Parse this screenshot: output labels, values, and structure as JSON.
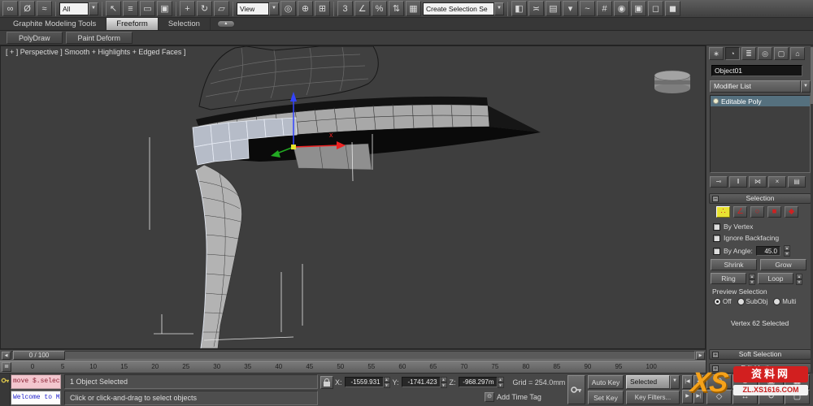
{
  "ui": {
    "dd_arrow": "▼",
    "left_arrow": "◀",
    "right_arrow": "▶",
    "spin_up": "▲",
    "spin_down": "▼",
    "minus": "−"
  },
  "toolbar": {
    "filter_dropdown": "All",
    "coord_dropdown": "View",
    "selection_set_dropdown": "Create Selection Se",
    "groups": {
      "link": [
        {
          "name": "select-and-link-icon",
          "glyph": "∞"
        },
        {
          "name": "unlink-selection-icon",
          "glyph": "Ø"
        },
        {
          "name": "bind-to-spacewarp-icon",
          "glyph": "≈"
        }
      ],
      "select": [
        {
          "name": "select-object-icon",
          "glyph": "↖"
        },
        {
          "name": "select-by-name-icon",
          "glyph": "≡"
        },
        {
          "name": "rectangular-selection-region-icon",
          "glyph": "▭"
        },
        {
          "name": "window-crossing-icon",
          "glyph": "▣"
        }
      ],
      "transform": [
        {
          "name": "select-and-move-icon",
          "glyph": "+"
        },
        {
          "name": "select-and-rotate-icon",
          "glyph": "↻"
        },
        {
          "name": "select-and-scale-icon",
          "glyph": "▱"
        }
      ],
      "pivot": [
        {
          "name": "use-pivot-point-center-icon",
          "glyph": "◎"
        },
        {
          "name": "select-and-manipulate-icon",
          "glyph": "⊕"
        },
        {
          "name": "keyboard-shortcut-override-icon",
          "glyph": "⊞"
        }
      ],
      "snap": [
        {
          "name": "snap-toggle-3d-icon",
          "glyph": "3"
        },
        {
          "name": "angle-snap-icon",
          "glyph": "∠"
        },
        {
          "name": "percent-snap-icon",
          "glyph": "%"
        },
        {
          "name": "spinner-snap-icon",
          "glyph": "⇅"
        },
        {
          "name": "named-selection-sets-icon",
          "glyph": "▦"
        }
      ],
      "tools": [
        {
          "name": "mirror-icon",
          "glyph": "◧"
        },
        {
          "name": "align-icon",
          "glyph": "≍"
        },
        {
          "name": "layer-manager-icon",
          "glyph": "▤"
        },
        {
          "name": "graphite-ribbon-toggle-icon",
          "glyph": "▾"
        },
        {
          "name": "curve-editor-icon",
          "glyph": "~"
        },
        {
          "name": "schematic-view-icon",
          "glyph": "#"
        },
        {
          "name": "material-editor-icon",
          "glyph": "◉"
        },
        {
          "name": "render-setup-icon",
          "glyph": "▣"
        },
        {
          "name": "rendered-frame-window-icon",
          "glyph": "◻"
        },
        {
          "name": "render-production-icon",
          "glyph": "◼"
        }
      ]
    }
  },
  "ribbon": {
    "toggle_glyph": "▴",
    "tabs": [
      {
        "name": "tab-graphite-modeling-tools",
        "label": "Graphite Modeling Tools"
      },
      {
        "name": "tab-freeform",
        "label": "Freeform",
        "active": true
      },
      {
        "name": "tab-selection",
        "label": "Selection"
      }
    ],
    "panels": [
      {
        "name": "panel-polydraw",
        "label": "PolyDraw"
      },
      {
        "name": "panel-paint-deform",
        "label": "Paint Deform"
      }
    ]
  },
  "viewport": {
    "label": "[ + ]  Perspective ]  Smooth + Highlights + Edged Faces ]",
    "gizmo_x_label": "x"
  },
  "timeline": {
    "slider_label": "0 / 100",
    "mini_curve_glyph": "≣",
    "ticks": [
      "0",
      "5",
      "10",
      "15",
      "20",
      "25",
      "30",
      "35",
      "40",
      "45",
      "50",
      "55",
      "60",
      "65",
      "70",
      "75",
      "80",
      "85",
      "90",
      "95",
      "100"
    ]
  },
  "maxscript": {
    "macro_line": "move $.selecte",
    "listener_line": "Welcome to MAX!"
  },
  "status": {
    "selected_line": "1 Object Selected",
    "prompt_line": "Click or click-and-drag to select objects",
    "x_label": "X:",
    "x_value": "-1559.931",
    "y_label": "Y:",
    "y_value": "-1741.423",
    "z_label": "Z:",
    "z_value": "-968.297m",
    "grid_label": "Grid = 254.0mm",
    "add_time_tag": "Add Time Tag",
    "add_time_tag_icon": "⊙",
    "auto_key": "Auto Key",
    "set_key": "Set Key",
    "selected_dropdown": "Selected",
    "key_filters": "Key Filters..."
  },
  "transport": {
    "time_controls": [
      {
        "name": "go-to-start-button",
        "glyph": "|◀"
      },
      {
        "name": "previous-frame-button",
        "glyph": "◀"
      },
      {
        "name": "play-button",
        "glyph": "▶"
      },
      {
        "name": "go-to-end-button",
        "glyph": "▶|"
      }
    ],
    "nav_controls": [
      {
        "name": "zoom-icon",
        "glyph": "⊙"
      },
      {
        "name": "zoom-all-icon",
        "glyph": "⊕"
      },
      {
        "name": "zoom-extents-icon",
        "glyph": "▣"
      },
      {
        "name": "zoom-extents-all-icon",
        "glyph": "▦"
      },
      {
        "name": "field-of-view-icon",
        "glyph": "◇"
      },
      {
        "name": "pan-icon",
        "glyph": "↔"
      },
      {
        "name": "orbit-icon",
        "glyph": "↻"
      },
      {
        "name": "maximize-viewport-icon",
        "glyph": "▢"
      }
    ]
  },
  "command_panel": {
    "tabs": [
      {
        "name": "create-tab-icon",
        "glyph": "∗"
      },
      {
        "name": "modify-tab-icon",
        "glyph": "◔",
        "active": true
      },
      {
        "name": "hierarchy-tab-icon",
        "glyph": "≣"
      },
      {
        "name": "motion-tab-icon",
        "glyph": "◎"
      },
      {
        "name": "display-tab-icon",
        "glyph": "▢"
      },
      {
        "name": "utilities-tab-icon",
        "glyph": "⌂"
      }
    ],
    "object_name": "Object01",
    "modifier_list_label": "Modifier List",
    "stack_item": "Editable Poly",
    "stack_tools": [
      {
        "name": "pin-stack-icon",
        "glyph": "⊸"
      },
      {
        "name": "show-end-result-icon",
        "glyph": "‖"
      },
      {
        "name": "make-unique-icon",
        "glyph": "⋈"
      },
      {
        "name": "remove-modifier-icon",
        "glyph": "×"
      },
      {
        "name": "configure-modifier-sets-icon",
        "glyph": "▤"
      }
    ],
    "selection": {
      "title": "Selection",
      "subobject": [
        {
          "name": "vertex-mode-icon",
          "glyph": "∴",
          "active": true
        },
        {
          "name": "edge-mode-icon",
          "glyph": "∠"
        },
        {
          "name": "border-mode-icon",
          "glyph": "○"
        },
        {
          "name": "polygon-mode-icon",
          "glyph": "■"
        },
        {
          "name": "element-mode-icon",
          "glyph": "◆"
        }
      ],
      "by_vertex": "By Vertex",
      "ignore_backfacing": "Ignore Backfacing",
      "by_angle": "By Angle:",
      "angle_value": "45.0",
      "shrink": "Shrink",
      "grow": "Grow",
      "ring": "Ring",
      "loop": "Loop",
      "preview_label": "Preview Selection",
      "preview_off": "Off",
      "preview_subobj": "SubObj",
      "preview_multi": "Multi",
      "status": "Vertex 62 Selected"
    },
    "rollouts": [
      {
        "name": "rollout-soft-selection",
        "label": "Soft Selection",
        "toggle": "+"
      },
      {
        "name": "rollout-edit-vertices",
        "label": "Edit Vertices",
        "toggle": "+"
      }
    ]
  },
  "watermark": {
    "logo": "XS",
    "site": "资料网",
    "url": "ZL.XS1616.COM"
  }
}
